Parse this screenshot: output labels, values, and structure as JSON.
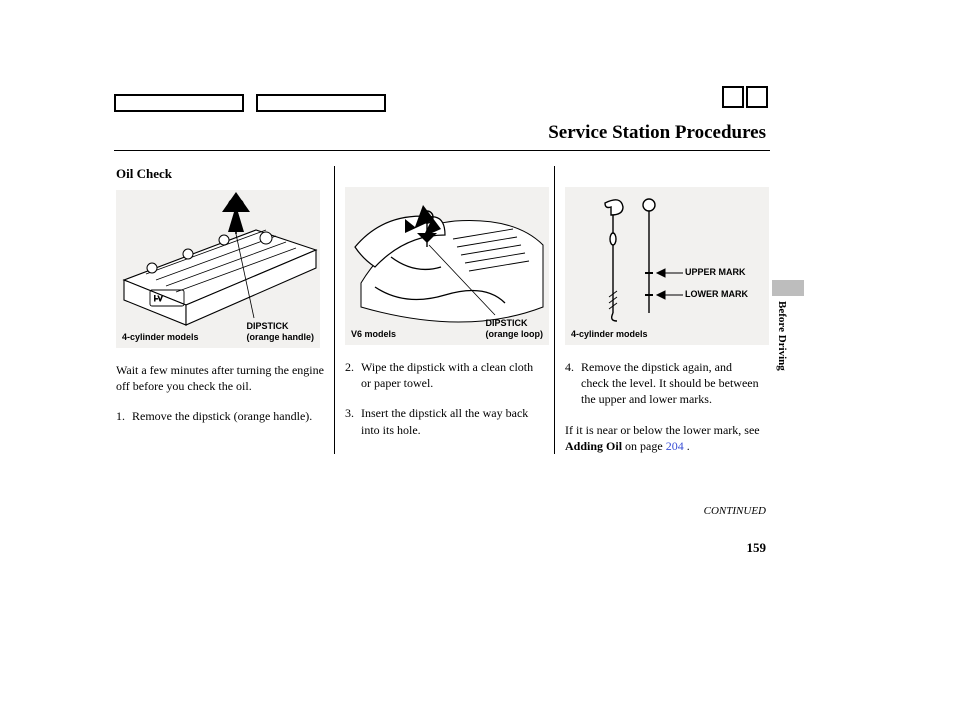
{
  "header": {
    "title": "Service Station Procedures"
  },
  "side_tab": "Before Driving",
  "section_heading": "Oil Check",
  "col1": {
    "fig": {
      "left_label": "4-cylinder models",
      "right_label_line1": "DIPSTICK",
      "right_label_line2": "(orange handle)"
    },
    "intro": "Wait a few minutes after turning the engine off before you check the oil.",
    "step1_n": "1.",
    "step1_t": "Remove the dipstick (orange handle)."
  },
  "col2": {
    "fig": {
      "left_label": "V6 models",
      "right_label_line1": "DIPSTICK",
      "right_label_line2": "(orange loop)"
    },
    "step2_n": "2.",
    "step2_t": "Wipe the dipstick with a clean cloth or paper towel.",
    "step3_n": "3.",
    "step3_t": "Insert the dipstick all the way back into its hole."
  },
  "col3": {
    "fig": {
      "left_label": "4-cylinder models",
      "upper": "UPPER MARK",
      "lower": "LOWER MARK"
    },
    "step4_n": "4.",
    "step4_t": "Remove the dipstick again, and check the level. It should be between the upper and lower marks.",
    "tail_pre": "If it is near or below the lower mark, see ",
    "tail_bold": "Adding Oil",
    "tail_mid": " on page ",
    "tail_link": "204",
    "tail_post": " ."
  },
  "footer": {
    "continued": "CONTINUED",
    "page": "159"
  }
}
